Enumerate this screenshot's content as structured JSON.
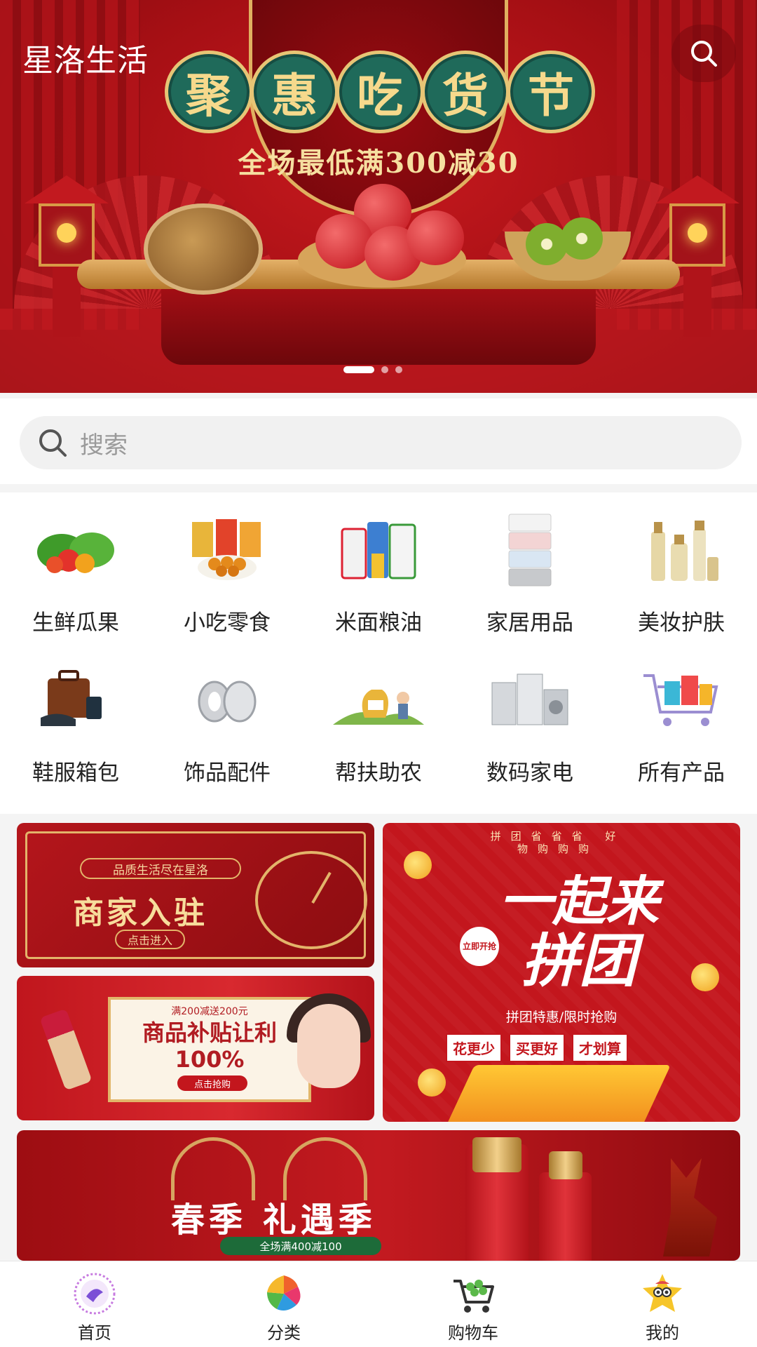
{
  "header": {
    "brand": "星洛生活",
    "search_icon": "search-icon"
  },
  "hero_banner": {
    "title_chars": [
      "聚",
      "惠",
      "吃",
      "货",
      "节"
    ],
    "subtitle": "全场最低满300减30",
    "slides_total": 3,
    "active_slide": 1
  },
  "search": {
    "placeholder": "搜索",
    "icon": "search-icon"
  },
  "categories": [
    {
      "label": "生鲜瓜果",
      "icon": "vegetables-icon"
    },
    {
      "label": "小吃零食",
      "icon": "snacks-icon"
    },
    {
      "label": "米面粮油",
      "icon": "grain-oil-icon"
    },
    {
      "label": "家居用品",
      "icon": "drawer-cabinet-icon"
    },
    {
      "label": "美妆护肤",
      "icon": "cosmetics-icon"
    },
    {
      "label": "鞋服箱包",
      "icon": "luggage-icon"
    },
    {
      "label": "饰品配件",
      "icon": "earrings-icon"
    },
    {
      "label": "帮扶助农",
      "icon": "farmer-aid-icon"
    },
    {
      "label": "数码家电",
      "icon": "appliances-icon"
    },
    {
      "label": "所有产品",
      "icon": "cart-gifts-icon"
    }
  ],
  "promos": {
    "merchant": {
      "pill": "品质生活尽在星洛",
      "title": "商家入驻",
      "button": "点击进入"
    },
    "subsidy": {
      "top": "满200减送200元",
      "title": "商品补贴让利100%",
      "button": "点击抢购"
    },
    "group_buy": {
      "top": "拼团省省省 好物购购购",
      "title_1": "一起来",
      "title_2": "拼团",
      "badge": "立即开抢",
      "line": "拼团特惠/限时抢购",
      "tags": [
        "花更少",
        "买更好",
        "才划算"
      ]
    },
    "spring": {
      "title": "春季 礼遇季",
      "bar": "全场满400减100"
    }
  },
  "tabbar": {
    "items": [
      {
        "label": "首页",
        "icon": "home-icon"
      },
      {
        "label": "分类",
        "icon": "category-icon"
      },
      {
        "label": "购物车",
        "icon": "shopping-cart-icon"
      },
      {
        "label": "我的",
        "icon": "profile-icon"
      }
    ]
  }
}
